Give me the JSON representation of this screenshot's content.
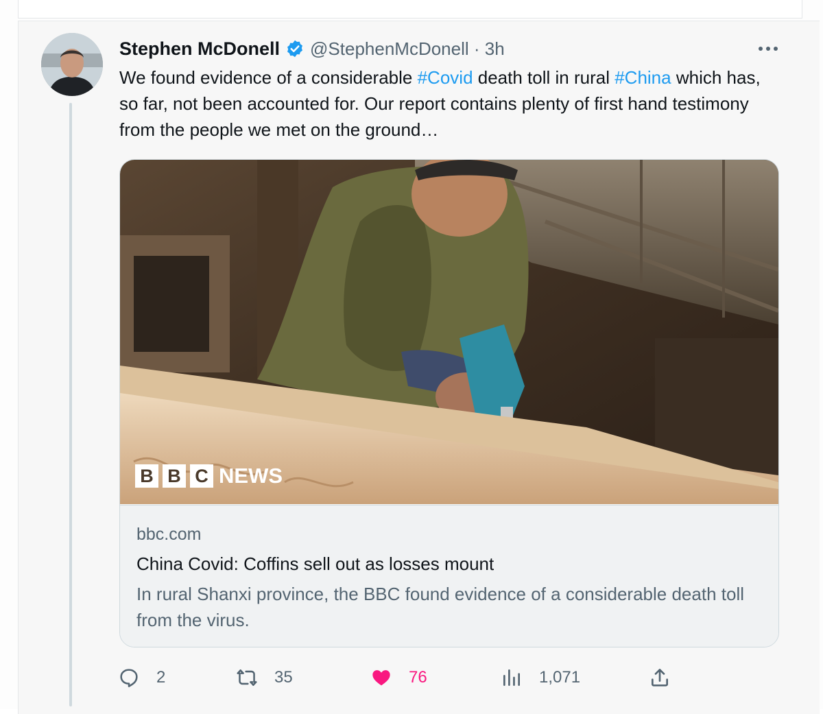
{
  "tweet": {
    "author_name": "Stephen McDonell",
    "handle_time": "@StephenMcDonell · 3h",
    "text": {
      "p1": "We found evidence of a considerable ",
      "tag1": "#Covid",
      "p2": " death toll in rural ",
      "tag2": "#China",
      "p3": " which has, so far, not been accounted for. Our report contains plenty of first hand testimony from the people we met on the ground…"
    }
  },
  "link_card": {
    "logo_letters": [
      "B",
      "B",
      "C"
    ],
    "logo_word": "NEWS",
    "domain": "bbc.com",
    "title": "China Covid: Coffins sell out as losses mount",
    "description": "In rural Shanxi province, the BBC found evidence of a considerable death toll from the virus."
  },
  "actions": {
    "reply_count": "2",
    "retweet_count": "35",
    "like_count": "76",
    "views_count": "1,071"
  },
  "icons": [
    "verified-badge-icon",
    "more-icon",
    "reply-icon",
    "retweet-icon",
    "heart-icon",
    "views-icon",
    "share-icon"
  ],
  "colors": {
    "accent": "#1d9bf0",
    "like": "#f91880",
    "muted": "#536471",
    "text": "#0f1419"
  }
}
